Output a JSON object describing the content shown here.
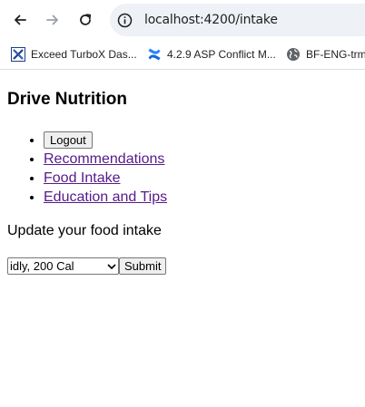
{
  "browser": {
    "url": "localhost:4200/intake",
    "bookmarks": [
      {
        "label": "Exceed TurboX Das...",
        "icon": "turbox-x-icon"
      },
      {
        "label": "4.2.9 ASP Conflict M...",
        "icon": "confluence-icon"
      },
      {
        "label": "BF-ENG-trm",
        "icon": "globe-icon"
      }
    ]
  },
  "page": {
    "title": "Drive Nutrition",
    "nav": {
      "logout_label": "Logout",
      "links": [
        "Recommendations",
        "Food Intake",
        "Education and Tips"
      ]
    },
    "prompt": "Update your food intake",
    "form": {
      "selected_food": "idly, 200 Cal",
      "submit_label": "Submit"
    }
  },
  "colors": {
    "visited_link": "#551a8b",
    "omnibox_bg": "#eef1f6"
  }
}
